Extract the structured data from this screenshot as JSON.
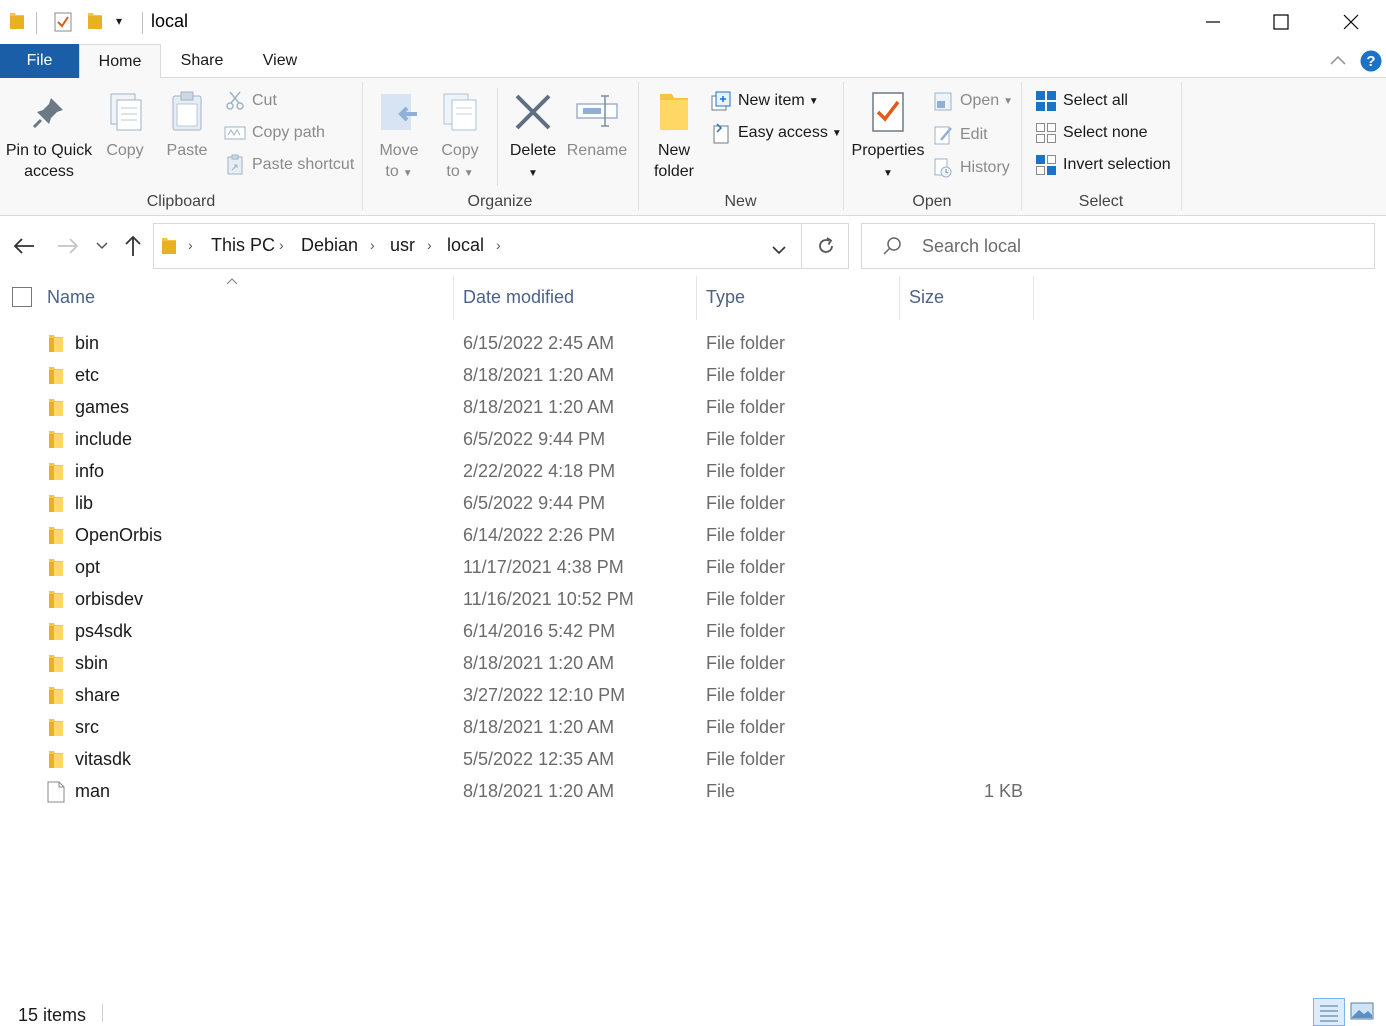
{
  "window": {
    "title": "local"
  },
  "tabs": {
    "file": "File",
    "home": "Home",
    "share": "Share",
    "view": "View"
  },
  "ribbon": {
    "clipboard": {
      "label": "Clipboard",
      "pin_line1": "Pin to Quick",
      "pin_line2": "access",
      "copy": "Copy",
      "paste": "Paste",
      "cut": "Cut",
      "copy_path": "Copy path",
      "paste_shortcut": "Paste shortcut"
    },
    "organize": {
      "label": "Organize",
      "move_line1": "Move",
      "move_line2": "to",
      "copy_line1": "Copy",
      "copy_line2": "to",
      "delete": "Delete",
      "rename": "Rename"
    },
    "new": {
      "label": "New",
      "folder_line1": "New",
      "folder_line2": "folder",
      "new_item": "New item",
      "easy_access": "Easy access"
    },
    "open": {
      "label": "Open",
      "properties": "Properties",
      "open": "Open",
      "edit": "Edit",
      "history": "History"
    },
    "select": {
      "label": "Select",
      "select_all": "Select all",
      "select_none": "Select none",
      "invert": "Invert selection"
    }
  },
  "address": {
    "crumbs": [
      "This PC",
      "Debian",
      "usr",
      "local"
    ]
  },
  "search": {
    "placeholder": "Search local"
  },
  "columns": {
    "name": "Name",
    "date": "Date modified",
    "type": "Type",
    "size": "Size"
  },
  "files": [
    {
      "name": "bin",
      "date": "6/15/2022 2:45 AM",
      "type": "File folder",
      "size": "",
      "icon": "folder-icon"
    },
    {
      "name": "etc",
      "date": "8/18/2021 1:20 AM",
      "type": "File folder",
      "size": "",
      "icon": "folder-icon"
    },
    {
      "name": "games",
      "date": "8/18/2021 1:20 AM",
      "type": "File folder",
      "size": "",
      "icon": "folder-icon"
    },
    {
      "name": "include",
      "date": "6/5/2022 9:44 PM",
      "type": "File folder",
      "size": "",
      "icon": "folder-icon"
    },
    {
      "name": "info",
      "date": "2/22/2022 4:18 PM",
      "type": "File folder",
      "size": "",
      "icon": "folder-icon"
    },
    {
      "name": "lib",
      "date": "6/5/2022 9:44 PM",
      "type": "File folder",
      "size": "",
      "icon": "folder-icon"
    },
    {
      "name": "OpenOrbis",
      "date": "6/14/2022 2:26 PM",
      "type": "File folder",
      "size": "",
      "icon": "folder-icon"
    },
    {
      "name": "opt",
      "date": "11/17/2021 4:38 PM",
      "type": "File folder",
      "size": "",
      "icon": "folder-icon"
    },
    {
      "name": "orbisdev",
      "date": "11/16/2021 10:52 PM",
      "type": "File folder",
      "size": "",
      "icon": "folder-icon"
    },
    {
      "name": "ps4sdk",
      "date": "6/14/2016 5:42 PM",
      "type": "File folder",
      "size": "",
      "icon": "folder-icon"
    },
    {
      "name": "sbin",
      "date": "8/18/2021 1:20 AM",
      "type": "File folder",
      "size": "",
      "icon": "folder-icon"
    },
    {
      "name": "share",
      "date": "3/27/2022 12:10 PM",
      "type": "File folder",
      "size": "",
      "icon": "folder-icon"
    },
    {
      "name": "src",
      "date": "8/18/2021 1:20 AM",
      "type": "File folder",
      "size": "",
      "icon": "folder-icon"
    },
    {
      "name": "vitasdk",
      "date": "5/5/2022 12:35 AM",
      "type": "File folder",
      "size": "",
      "icon": "folder-icon"
    },
    {
      "name": "man",
      "date": "8/18/2021 1:20 AM",
      "type": "File",
      "size": "1 KB",
      "icon": "file-icon"
    }
  ],
  "status": {
    "count": "15 items"
  },
  "colors": {
    "file_tab": "#1a5ea8",
    "folder": "#f4c542",
    "accent": "#1a73c7"
  }
}
